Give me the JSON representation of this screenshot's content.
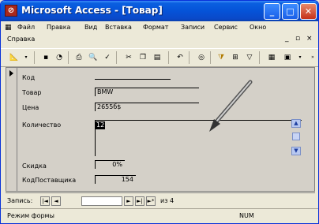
{
  "window": {
    "app_icon": "access-key-icon",
    "app_icon_glyph": "⊘",
    "title": "Microsoft Access - [Товар]",
    "minimize": "_",
    "maximize": "□",
    "close": "✕"
  },
  "menubar": {
    "items": [
      "Файл",
      "Правка",
      "Вид",
      "Вставка",
      "Формат",
      "Записи",
      "Сервис",
      "Окно"
    ],
    "help": "Справка",
    "mdi_minimize": "_",
    "mdi_restore": "▫",
    "mdi_close": "×"
  },
  "toolbar": {
    "buttons": [
      {
        "name": "view-icon",
        "glyph": "📐"
      },
      {
        "name": "save-icon",
        "glyph": "▪"
      },
      {
        "name": "search-icon",
        "glyph": "◔"
      },
      {
        "name": "print-icon",
        "glyph": "⎙"
      },
      {
        "name": "preview-icon",
        "glyph": "🔍"
      },
      {
        "name": "spelling-icon",
        "glyph": "✓"
      },
      {
        "name": "cut-icon",
        "glyph": "✂"
      },
      {
        "name": "copy-icon",
        "glyph": "❐"
      },
      {
        "name": "paste-icon",
        "glyph": "▤"
      },
      {
        "name": "undo-icon",
        "glyph": "↶"
      },
      {
        "name": "hyperlink-icon",
        "glyph": "◎"
      },
      {
        "name": "filter-by-selection-icon",
        "glyph": "⧩"
      },
      {
        "name": "filter-by-form-icon",
        "glyph": "⊞"
      },
      {
        "name": "apply-filter-icon",
        "glyph": "▽"
      },
      {
        "name": "properties-icon",
        "glyph": "▦"
      },
      {
        "name": "new-object-icon",
        "glyph": "▣"
      }
    ]
  },
  "form": {
    "fields": [
      {
        "label": "Код",
        "value": ""
      },
      {
        "label": "Товар",
        "value": "BMW"
      },
      {
        "label": "Цена",
        "value": "2655б$"
      },
      {
        "label": "Количество",
        "value": "12"
      },
      {
        "label": "Скидка",
        "value": "0%"
      },
      {
        "label": "КодПоставщика",
        "value": "154"
      }
    ]
  },
  "navigation": {
    "label": "Запись:",
    "first": "|◄",
    "prev": "◄",
    "current": "",
    "next": "►",
    "last": "►|",
    "new": "►*",
    "of_label": "из 4"
  },
  "status": {
    "mode": "Режим формы",
    "num": "NUM"
  }
}
